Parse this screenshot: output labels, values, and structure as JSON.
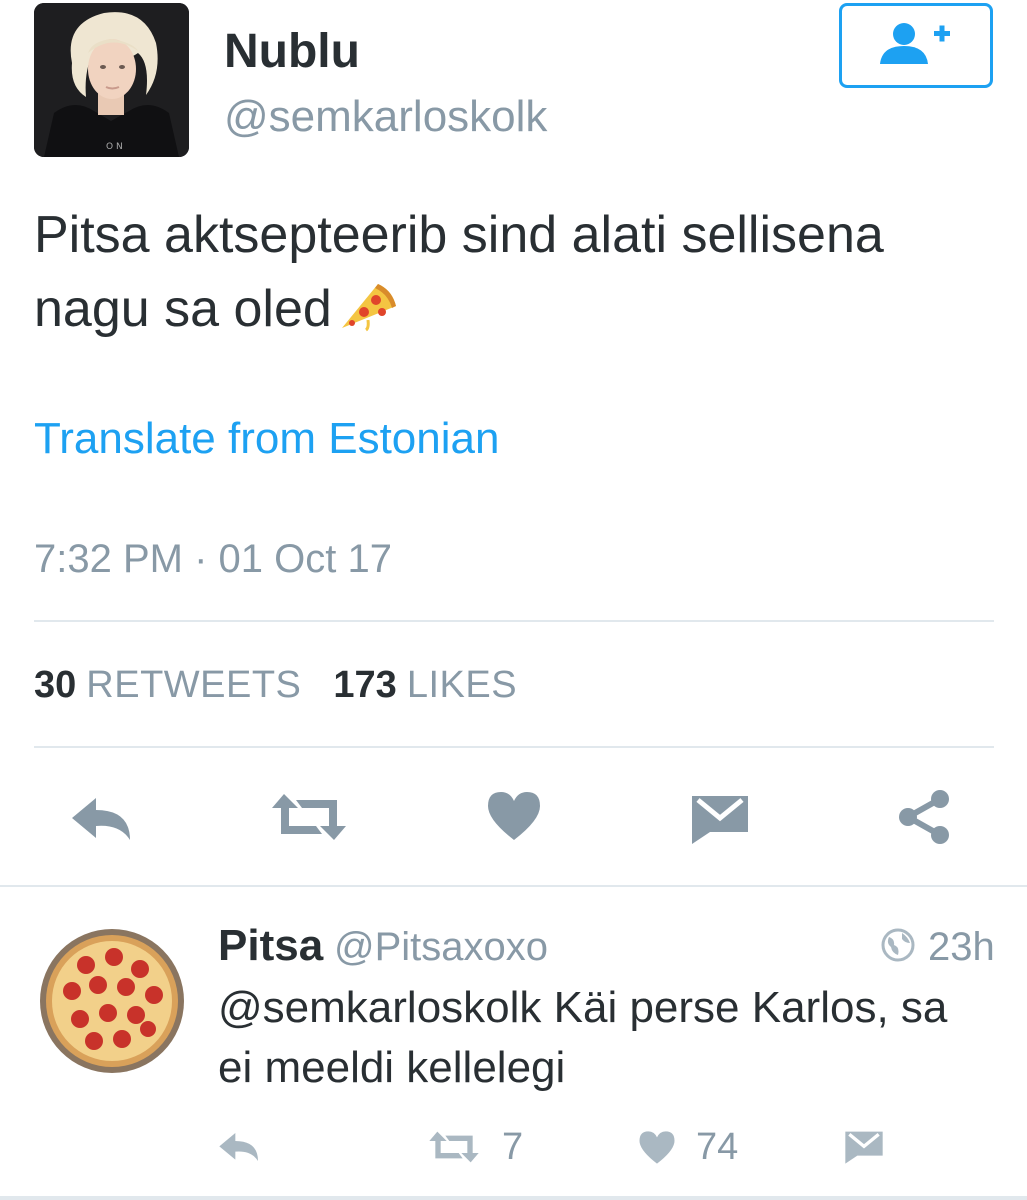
{
  "tweet": {
    "display_name": "Nublu",
    "handle": "@semkarloskolk",
    "text_line1": "Pitsa aktsepteerib sind alati sellisena",
    "text_line2": "nagu sa oled",
    "emoji_icon": "pizza-slice-emoji",
    "translate_label": "Translate from Estonian",
    "timestamp": "7:32 PM · 01 Oct 17",
    "retweet_count": "30",
    "retweet_label": "RETWEETS",
    "like_count": "173",
    "like_label": "LIKES"
  },
  "actions": [
    "reply-icon",
    "retweet-icon",
    "like-icon",
    "message-icon",
    "share-icon"
  ],
  "reply": {
    "display_name": "Pitsa",
    "handle": "@Pitsaxoxo",
    "time": "23h",
    "text_line1": "@semkarloskolk Käi perse Karlos, sa",
    "text_line2": "ei meeldi kellelegi",
    "retweet_count": "7",
    "like_count": "74"
  },
  "colors": {
    "accent": "#1da1f2",
    "text": "#292f33",
    "muted": "#8899a6",
    "icon": "#8899a6",
    "divider": "#e1e8ed"
  }
}
